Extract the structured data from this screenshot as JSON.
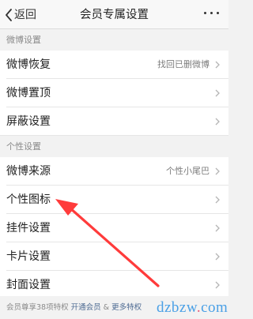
{
  "header": {
    "back_label": "返回",
    "title": "会员专属设置"
  },
  "sections": [
    {
      "title": "微博设置",
      "items": [
        {
          "label": "微博恢复",
          "value": "找回已删微博"
        },
        {
          "label": "微博置顶",
          "value": ""
        },
        {
          "label": "屏蔽设置",
          "value": ""
        }
      ]
    },
    {
      "title": "个性设置",
      "items": [
        {
          "label": "微博来源",
          "value": "个性小尾巴"
        },
        {
          "label": "个性图标",
          "value": ""
        },
        {
          "label": "挂件设置",
          "value": ""
        },
        {
          "label": "卡片设置",
          "value": ""
        },
        {
          "label": "封面设置",
          "value": ""
        }
      ]
    }
  ],
  "footer": {
    "text": "会员尊享38项特权",
    "link_open": "开通会员",
    "separator": "&",
    "link_more": "更多特权"
  },
  "watermark": {
    "text_a": "dzbzw",
    "dot": ".",
    "text_b": "com"
  },
  "colors": {
    "annotation_arrow": "#ff3b3b",
    "link": "#4d6a92"
  },
  "icons": [
    "chevron-left-icon",
    "more-icon",
    "chevron-right-icon"
  ]
}
